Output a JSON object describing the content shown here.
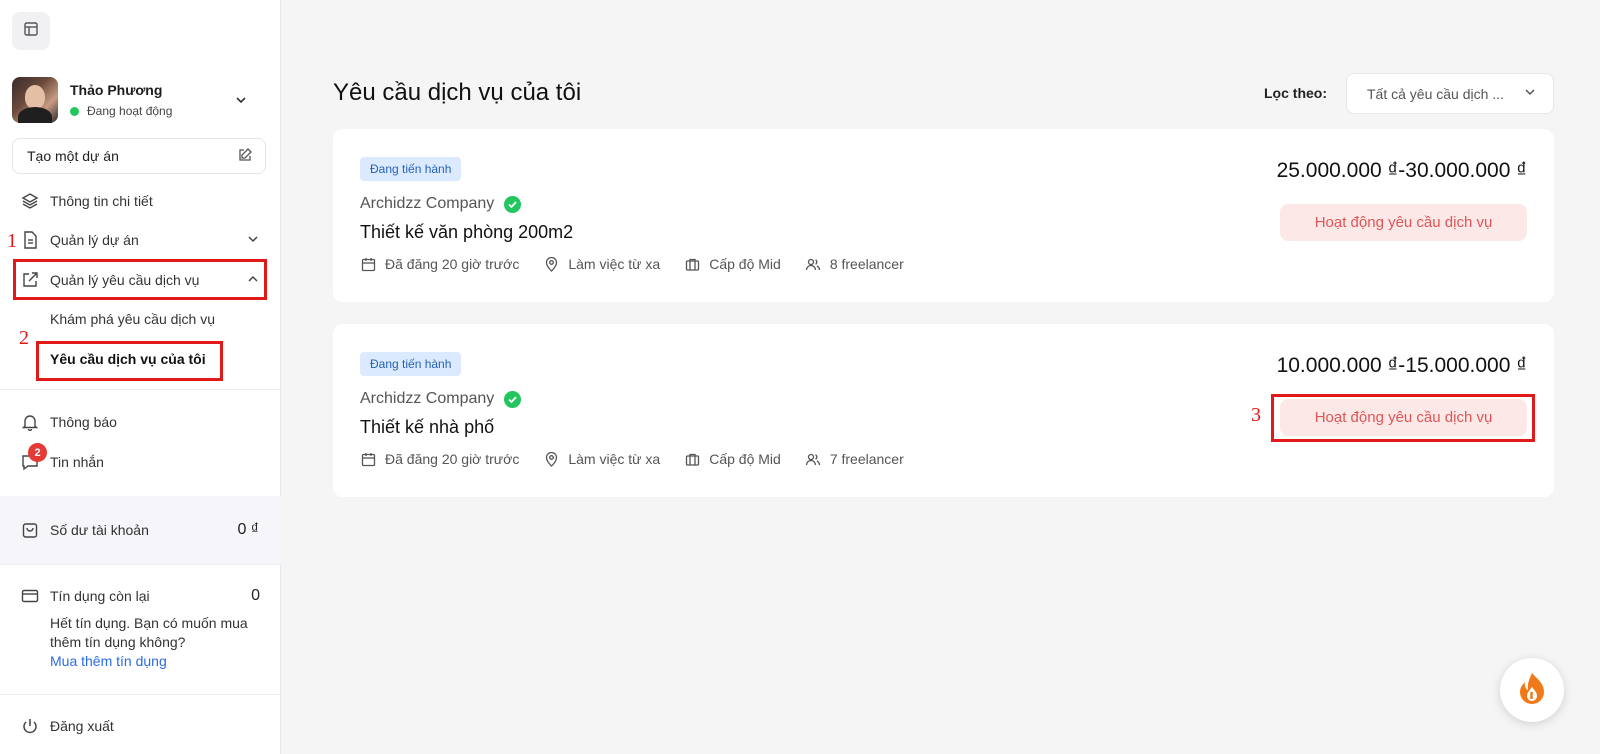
{
  "sidebar": {
    "profile": {
      "name": "Thảo Phương",
      "status": "Đang hoạt động"
    },
    "create_project": "Tạo một dự án",
    "items": {
      "details": "Thông tin chi tiết",
      "project_mgmt": "Quản lý dự án",
      "service_mgmt": "Quản lý yêu cầu dịch vụ",
      "explore": "Khám phá yêu cầu dịch vụ",
      "my_requests": "Yêu cầu dịch vụ của tôi",
      "notifications": "Thông báo",
      "messages": "Tin nhắn",
      "messages_badge": "2"
    },
    "balance": {
      "label": "Số dư tài khoản",
      "value": "0 ₫"
    },
    "credit": {
      "label": "Tín dụng còn lại",
      "value": "0",
      "message": "Hết tín dụng. Bạn có muốn mua thêm tín dụng không?",
      "link": "Mua thêm tín dụng"
    },
    "logout": "Đăng xuất"
  },
  "annotations": {
    "one": "1",
    "two": "2",
    "three": "3"
  },
  "main": {
    "title": "Yêu cầu dịch vụ của tôi",
    "filter_label": "Lọc theo:",
    "filter_value": "Tất cả yêu cầu dịch ...",
    "cards": [
      {
        "status": "Đang tiến hành",
        "company": "Archidzz Company",
        "title": "Thiết kế văn phòng 200m2",
        "posted": "Đã đăng 20 giờ trước",
        "location": "Làm việc từ xa",
        "level": "Cấp độ Mid",
        "freelancers": "8 freelancer",
        "price": "25.000.000 ₫-30.000.000 ₫",
        "action": "Hoạt động yêu cầu dịch vụ"
      },
      {
        "status": "Đang tiến hành",
        "company": "Archidzz Company",
        "title": "Thiết kế nhà phố",
        "posted": "Đã đăng 20 giờ trước",
        "location": "Làm việc từ xa",
        "level": "Cấp độ Mid",
        "freelancers": "7 freelancer",
        "price": "10.000.000 ₫-15.000.000 ₫",
        "action": "Hoạt động yêu cầu dịch vụ"
      }
    ]
  },
  "colors": {
    "accent_red": "#e11919",
    "status_blue": "#2563b8",
    "action_bg": "#fde8e8",
    "online": "#22c55e"
  }
}
